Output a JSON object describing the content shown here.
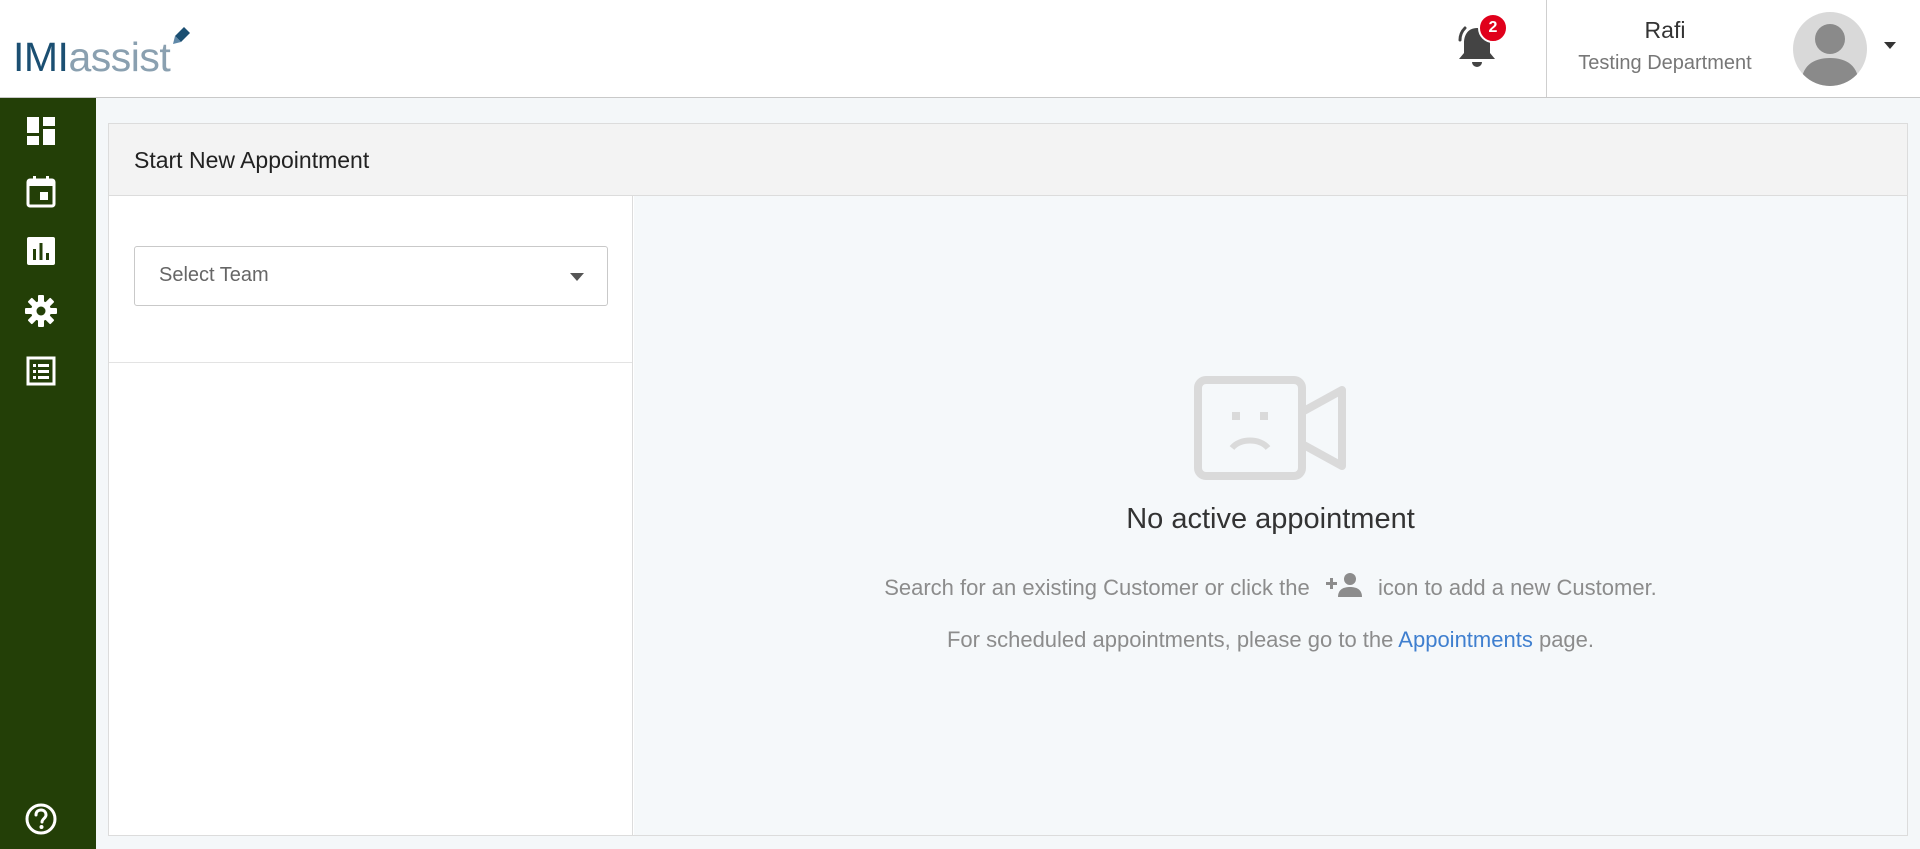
{
  "header": {
    "logo": {
      "part1": "IMI",
      "part2": "assist"
    },
    "notifications": {
      "count": "2"
    },
    "user": {
      "name": "Rafi",
      "department": "Testing Department"
    }
  },
  "sidebar": {
    "items": [
      {
        "name": "dashboard",
        "icon": "dashboard-icon"
      },
      {
        "name": "calendar",
        "icon": "calendar-icon"
      },
      {
        "name": "reports",
        "icon": "bar-chart-icon"
      },
      {
        "name": "settings",
        "icon": "gear-icon"
      },
      {
        "name": "list",
        "icon": "list-icon"
      },
      {
        "name": "help",
        "icon": "help-icon"
      }
    ]
  },
  "main": {
    "title": "Start New Appointment",
    "select_team": {
      "placeholder": "Select Team"
    },
    "empty_state": {
      "title": "No active appointment",
      "line1_before": "Search for an existing Customer or click the",
      "line1_after": "icon to add a new Customer.",
      "line2_before": "For scheduled appointments, please go to the",
      "line2_link": "Appointments",
      "line2_after": "page."
    }
  },
  "colors": {
    "sidebar_bg": "#233f07",
    "badge": "#e0001b",
    "link": "#3f7fcf",
    "logo_dark": "#1b4f72",
    "logo_light": "#8aa0b0"
  }
}
